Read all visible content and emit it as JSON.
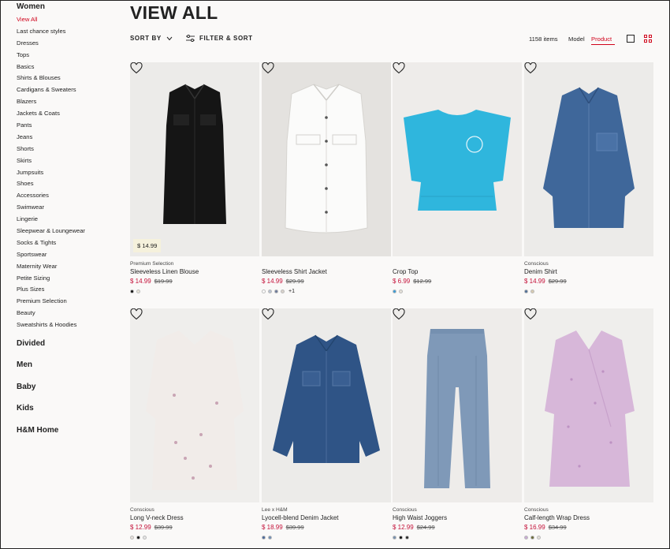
{
  "sidebar": {
    "title": "Women",
    "items": [
      "View All",
      "Last chance styles",
      "Dresses",
      "Tops",
      "Basics",
      "Shirts & Blouses",
      "Cardigans & Sweaters",
      "Blazers",
      "Jackets & Coats",
      "Pants",
      "Jeans",
      "Shorts",
      "Skirts",
      "Jumpsuits",
      "Shoes",
      "Accessories",
      "Swimwear",
      "Lingerie",
      "Sleepwear & Loungewear",
      "Socks & Tights",
      "Sportswear",
      "Maternity Wear",
      "Petite Sizing",
      "Plus Sizes",
      "Premium Selection",
      "Beauty",
      "Sweatshirts & Hoodies"
    ],
    "active_index": 0,
    "categories": [
      "Divided",
      "Men",
      "Baby",
      "Kids",
      "H&M Home"
    ]
  },
  "header": {
    "title": "VIEW ALL",
    "sort_label": "SORT BY",
    "filter_label": "FILTER & SORT",
    "item_count": "1158 items",
    "view_model": "Model",
    "view_product": "Product"
  },
  "colors": {
    "accent": "#d0021b",
    "sale": "#c4123a"
  },
  "products": [
    {
      "label": "Premium Selection",
      "name": "Sleeveless Linen Blouse",
      "price": "$ 14.99",
      "orig": "$19.99",
      "tag": "$ 14.99",
      "swatches": [
        "#111111",
        "#e9e4d8"
      ],
      "more": ""
    },
    {
      "label": "",
      "name": "Sleeveless Shirt Jacket",
      "price": "$ 14.99",
      "orig": "$29.99",
      "tag": "",
      "swatches": [
        "#ffffff",
        "#b8c2d2",
        "#6c7a9a",
        "#d9d3cc"
      ],
      "more": "+1"
    },
    {
      "label": "",
      "name": "Crop Top",
      "price": "$ 6.99",
      "orig": "$12.99",
      "tag": "",
      "swatches": [
        "#3a9bd6",
        "#e6e2da"
      ],
      "more": ""
    },
    {
      "label": "Conscious",
      "name": "Denim Shirt",
      "price": "$ 14.99",
      "orig": "$29.99",
      "tag": "",
      "swatches": [
        "#4f6f97",
        "#d8cbb0"
      ],
      "more": ""
    },
    {
      "label": "Conscious",
      "name": "Long V-neck Dress",
      "price": "$ 12.99",
      "orig": "$39.99",
      "tag": "",
      "swatches": [
        "#e8e1dc",
        "#111111",
        "#e6e6e6"
      ],
      "more": ""
    },
    {
      "label": "Lee x H&M",
      "name": "Lyocell-blend Denim Jacket",
      "price": "$ 18.99",
      "orig": "$39.99",
      "tag": "",
      "swatches": [
        "#4a6a9a",
        "#6f8eb5"
      ],
      "more": ""
    },
    {
      "label": "Conscious",
      "name": "High Waist Joggers",
      "price": "$ 12.99",
      "orig": "$24.99",
      "tag": "",
      "swatches": [
        "#7690ad",
        "#111111",
        "#2a2a2a"
      ],
      "more": ""
    },
    {
      "label": "Conscious",
      "name": "Calf-length Wrap Dress",
      "price": "$ 16.99",
      "orig": "$34.99",
      "tag": "",
      "swatches": [
        "#c8a9d4",
        "#6b6b3a",
        "#e5e0da"
      ],
      "more": ""
    }
  ]
}
